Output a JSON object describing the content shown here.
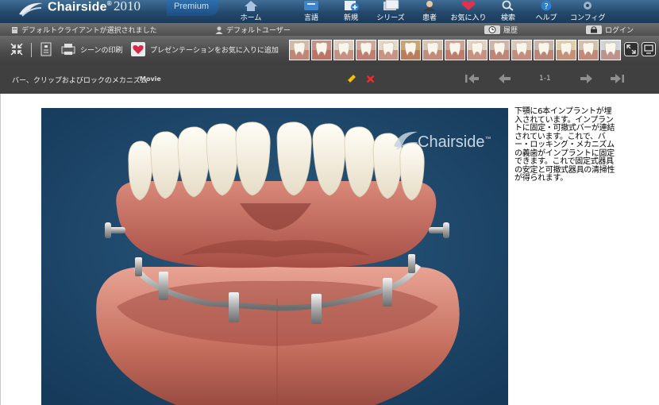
{
  "app": {
    "name": "Chairside",
    "registered_mark": "®",
    "year": "2010",
    "edition": "Premium"
  },
  "nav": [
    {
      "label": "ホーム",
      "icon": "home-icon"
    },
    {
      "label": "言語",
      "icon": "language-icon"
    },
    {
      "label": "新規",
      "icon": "new-icon"
    },
    {
      "label": "シリーズ",
      "icon": "series-icon"
    },
    {
      "label": "患者",
      "icon": "patient-icon"
    },
    {
      "label": "お気に入り",
      "icon": "favorites-icon"
    },
    {
      "label": "検索",
      "icon": "search-icon"
    },
    {
      "label": "ヘルプ",
      "icon": "help-icon"
    },
    {
      "label": "コンフィグ",
      "icon": "config-icon"
    }
  ],
  "status": {
    "client": "デフォルトクライアントが選択されました",
    "user": "デフォルトユーザー",
    "history": "履歴",
    "login": "ログイン"
  },
  "toolbar": {
    "print_scene": "シーンの印刷",
    "add_presentation": "プレゼンテーションをお気に入りに追加",
    "thumbnail_count": 15
  },
  "title": {
    "text": "バー、クリップおよびロックのメカニズム",
    "kind": "Movie",
    "page": "1-1"
  },
  "media": {
    "watermark": "Chairside",
    "watermark_mark": "™"
  },
  "description": "下顎に6本インプラントが埋入されています。インプラントに固定・可撤式バーが連結されています。これで、バー・ロッキング・メカニズムの義歯がインプラントに固定できます。これで固定式器具の安定と可撤式器具の清掃性が得られます。",
  "colors": {
    "topbar": "#24496c",
    "premium": "#1d4f84",
    "toolbar": "#4e4e4e",
    "titlebar": "#404040",
    "media_bg": "#1d4466",
    "gum": "#c86b5c",
    "tooth": "#f3eee2",
    "edit_pencil": "#f2c200",
    "delete_x": "#e53030"
  }
}
